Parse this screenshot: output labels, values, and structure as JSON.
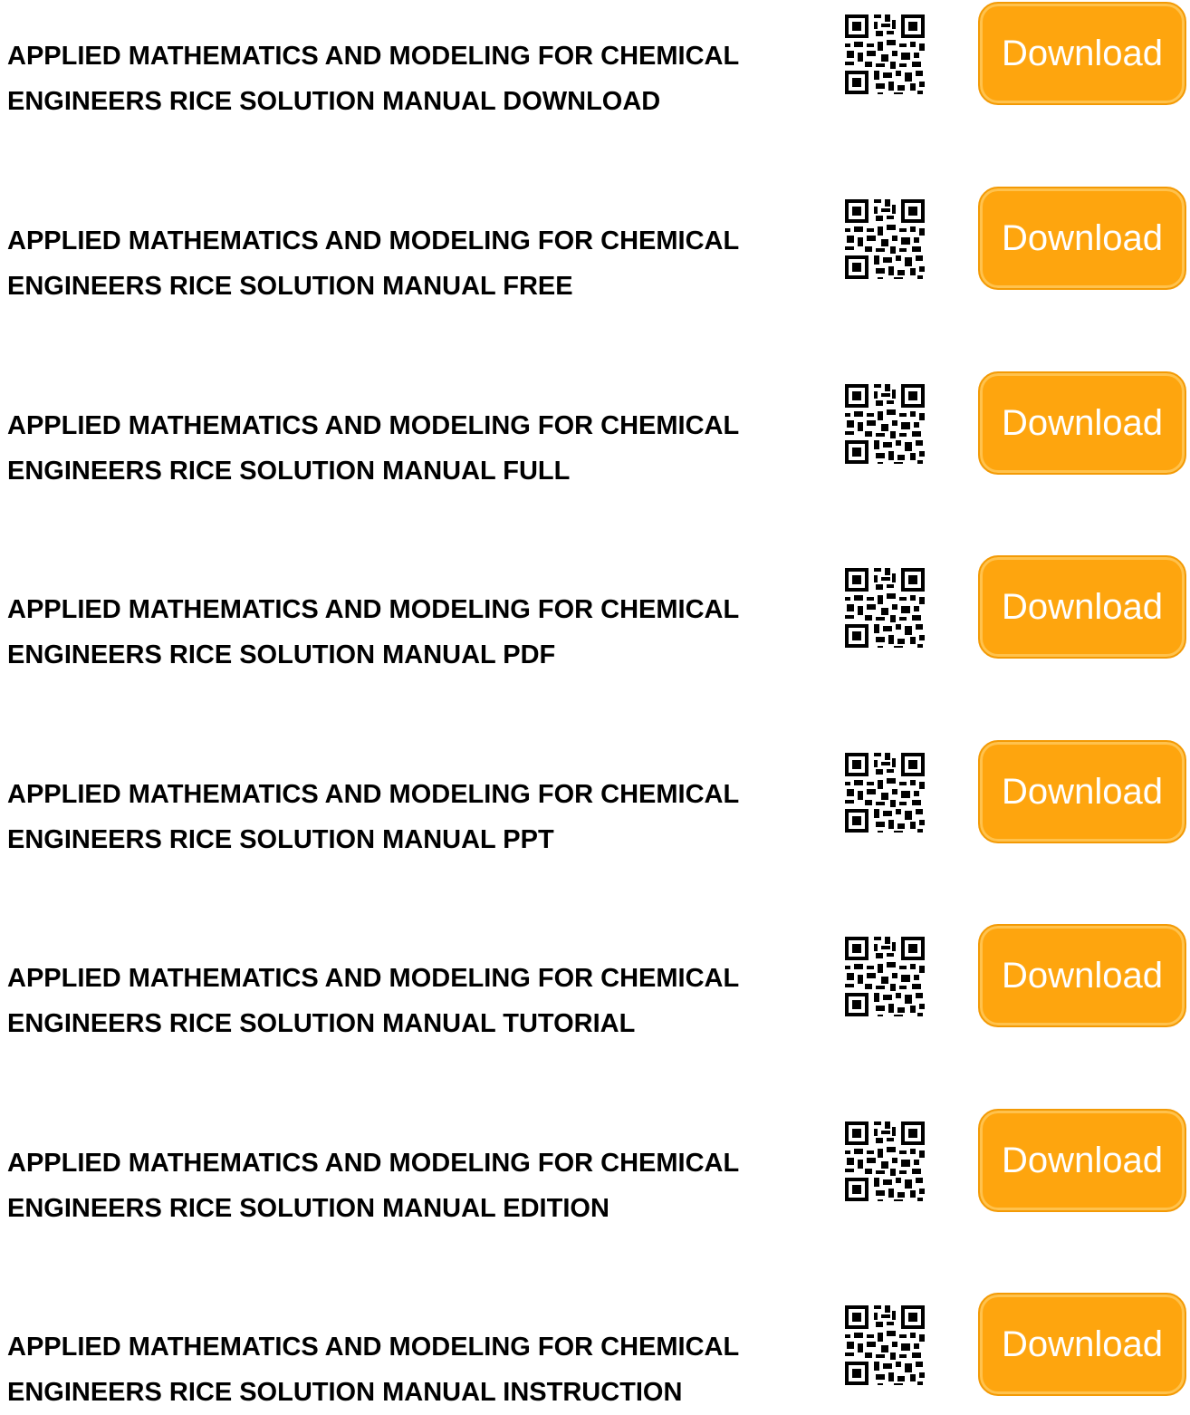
{
  "colors": {
    "button_fill": "#fea50e",
    "button_border": "#f39a05",
    "button_text": "#ffffff",
    "title_text": "#000000"
  },
  "icons": {
    "qr": "qr-code-icon"
  },
  "items": [
    {
      "line1": "APPLIED MATHEMATICS AND MODELING FOR CHEMICAL",
      "line2": "ENGINEERS RICE SOLUTION MANUAL DOWNLOAD",
      "button_label": "Download"
    },
    {
      "line1": "APPLIED MATHEMATICS AND MODELING FOR CHEMICAL",
      "line2": "ENGINEERS RICE SOLUTION MANUAL FREE",
      "button_label": "Download"
    },
    {
      "line1": "APPLIED MATHEMATICS AND MODELING FOR CHEMICAL",
      "line2": "ENGINEERS RICE SOLUTION MANUAL FULL",
      "button_label": "Download"
    },
    {
      "line1": "APPLIED MATHEMATICS AND MODELING FOR CHEMICAL",
      "line2": "ENGINEERS RICE SOLUTION MANUAL PDF",
      "button_label": "Download"
    },
    {
      "line1": "APPLIED MATHEMATICS AND MODELING FOR CHEMICAL",
      "line2": "ENGINEERS RICE SOLUTION MANUAL PPT",
      "button_label": "Download"
    },
    {
      "line1": "APPLIED MATHEMATICS AND MODELING FOR CHEMICAL",
      "line2": "ENGINEERS RICE SOLUTION MANUAL TUTORIAL",
      "button_label": "Download"
    },
    {
      "line1": "APPLIED MATHEMATICS AND MODELING FOR CHEMICAL",
      "line2": "ENGINEERS RICE SOLUTION MANUAL EDITION",
      "button_label": "Download"
    },
    {
      "line1": "APPLIED MATHEMATICS AND MODELING FOR CHEMICAL",
      "line2": "ENGINEERS RICE SOLUTION MANUAL INSTRUCTION",
      "button_label": "Download"
    }
  ]
}
